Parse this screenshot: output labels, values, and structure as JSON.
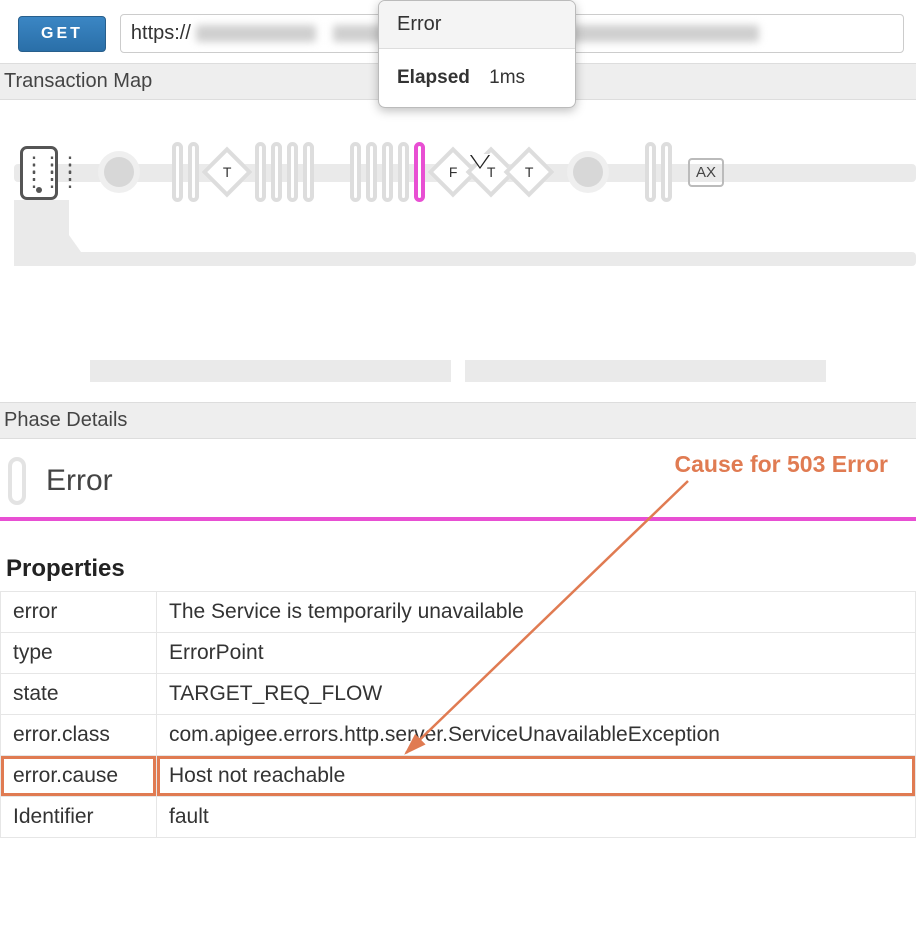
{
  "request_row": {
    "method": "GET",
    "url_visible_prefix": "https://",
    "url_hidden_after_prefix": true
  },
  "tooltip": {
    "title": "Error",
    "elapsed_label": "Elapsed",
    "elapsed_value": "1ms"
  },
  "sections": {
    "transaction_map": "Transaction Map",
    "phase_details": "Phase Details"
  },
  "flow_labels": {
    "diamond_t": "T",
    "diamond_f": "F",
    "end_box": "AX"
  },
  "phase": {
    "name": "Error"
  },
  "properties": {
    "heading": "Properties",
    "rows": [
      {
        "key": "error",
        "value": "The Service is temporarily unavailable"
      },
      {
        "key": "type",
        "value": "ErrorPoint"
      },
      {
        "key": "state",
        "value": "TARGET_REQ_FLOW"
      },
      {
        "key": "error.class",
        "value": "com.apigee.errors.http.server.ServiceUnavailableException"
      },
      {
        "key": "error.cause",
        "value": "Host not reachable"
      },
      {
        "key": "Identifier",
        "value": "fault"
      }
    ],
    "highlight_index": 4
  },
  "annotation": {
    "label": "Cause for 503 Error"
  }
}
